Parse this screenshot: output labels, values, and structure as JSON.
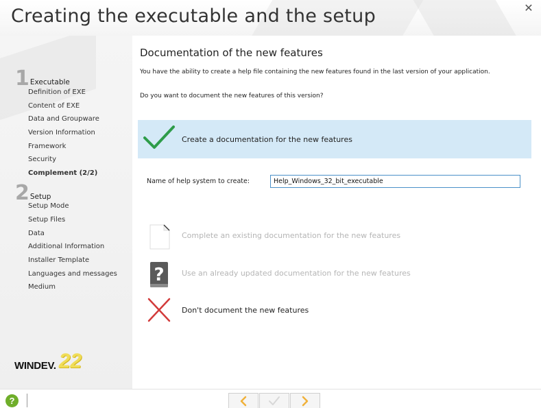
{
  "window": {
    "title": "Creating the executable and the setup",
    "close_glyph": "✕"
  },
  "sidebar": {
    "steps": [
      {
        "number": "1",
        "label": "Executable",
        "items": [
          {
            "label": "Definition of EXE",
            "active": false
          },
          {
            "label": "Content of EXE",
            "active": false
          },
          {
            "label": "Data and Groupware",
            "active": false
          },
          {
            "label": "Version Information",
            "active": false
          },
          {
            "label": "Framework",
            "active": false
          },
          {
            "label": "Security",
            "active": false
          },
          {
            "label": "Complement (2/2)",
            "active": true
          }
        ]
      },
      {
        "number": "2",
        "label": "Setup",
        "items": [
          {
            "label": "Setup Mode",
            "active": false
          },
          {
            "label": "Setup Files",
            "active": false
          },
          {
            "label": "Data",
            "active": false
          },
          {
            "label": "Additional Information",
            "active": false
          },
          {
            "label": "Installer Template",
            "active": false
          },
          {
            "label": "Languages and messages",
            "active": false
          },
          {
            "label": "Medium",
            "active": false
          }
        ]
      }
    ],
    "logo": {
      "text": "WINDEV.",
      "version": "22"
    }
  },
  "main": {
    "heading": "Documentation of the new features",
    "intro": "You have the ability to create a help file containing the new features found in the last version of your application.",
    "question": "Do you want to document the new features of this version?",
    "options": [
      {
        "label": "Create a documentation for the new features",
        "icon": "checkmark-icon",
        "selected": true,
        "disabled": false
      },
      {
        "label": "Complete an existing documentation for the new features",
        "icon": "document-icon",
        "selected": false,
        "disabled": true
      },
      {
        "label": "Use an already updated documentation for the new features",
        "icon": "help-book-icon",
        "selected": false,
        "disabled": true
      },
      {
        "label": "Don't document the new features",
        "icon": "cross-icon",
        "selected": false,
        "disabled": false
      }
    ],
    "help_name_field": {
      "label": "Name of help system to create:",
      "value": "Help_Windows_32_bit_executable"
    }
  },
  "footer": {
    "help_glyph": "?",
    "prev_glyph": "<",
    "finish_glyph": "✓",
    "next_glyph": ">"
  },
  "colors": {
    "selected_option_bg": "#d4e9f7",
    "check_green": "#2e9c4a",
    "cross_red": "#d23a3a",
    "nav_arrow": "#f0b13a",
    "help_green": "#6fae2a",
    "disabled_text": "#b5b5b5"
  }
}
